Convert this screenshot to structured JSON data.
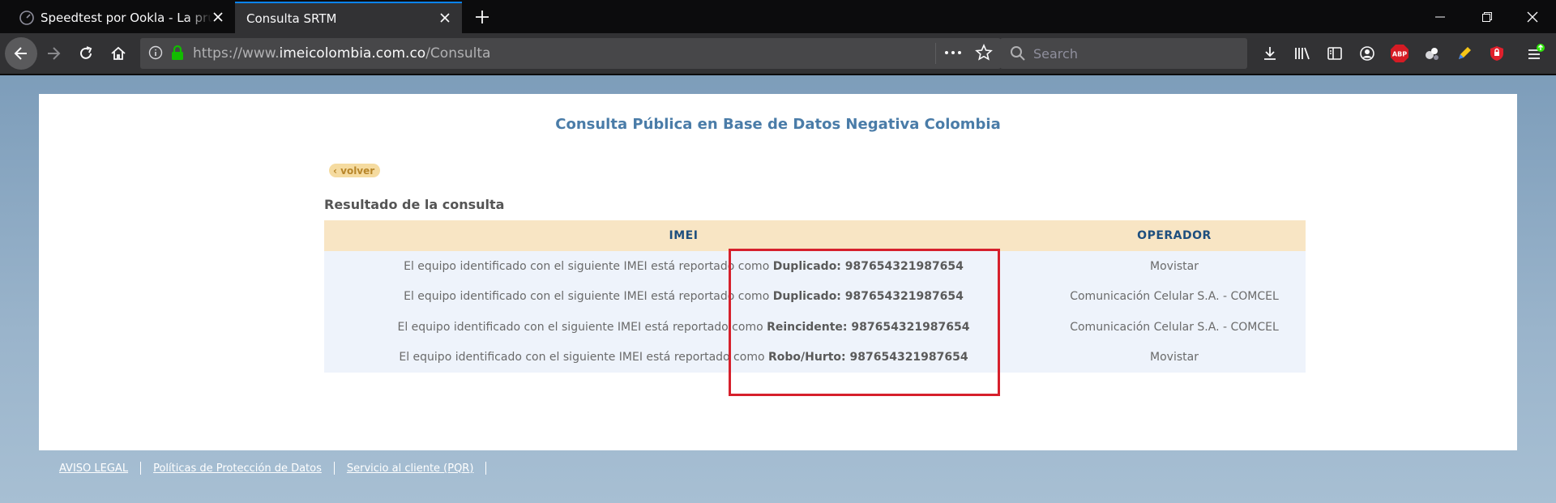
{
  "browser": {
    "tabs": [
      {
        "title": "Speedtest por Ookla - La prueba",
        "icon": "speedometer-icon",
        "active": false
      },
      {
        "title": "Consulta SRTM",
        "icon": "none",
        "active": true
      }
    ],
    "url_prefix": "https://www.",
    "url_host": "imeicolombia.com.co",
    "url_path": "/Consulta",
    "search_placeholder": "Search",
    "accent_color": "#0a84ff",
    "toolbar_icons": [
      "download-icon",
      "library-icon",
      "sidebar-icon",
      "account-icon",
      "adblock-plus-icon",
      "extension-icon",
      "pencil-extension-icon",
      "shield-extension-icon",
      "menu-icon"
    ],
    "adblock_label": "ABP"
  },
  "page": {
    "title": "Consulta Pública en Base de Datos Negativa Colombia",
    "back_label": "‹ volver",
    "section_title": "Resultado de la consulta",
    "table": {
      "headers": [
        "IMEI",
        "OPERADOR"
      ],
      "rows": [
        {
          "text": "El equipo identificado con el siguiente IMEI está reportado como ",
          "status": "Duplicado: 987654321987654",
          "operator": "Movistar"
        },
        {
          "text": "El equipo identificado con el siguiente IMEI está reportado como ",
          "status": "Duplicado: 987654321987654",
          "operator": "Comunicación Celular S.A. - COMCEL"
        },
        {
          "text": "El equipo identificado con el siguiente IMEI está reportado como ",
          "status": "Reincidente: 987654321987654",
          "operator": "Comunicación Celular S.A. - COMCEL"
        },
        {
          "text": "El equipo identificado con el siguiente IMEI está reportado como ",
          "status": "Robo/Hurto: 987654321987654",
          "operator": "Movistar"
        }
      ]
    },
    "highlight_color": "#d6202c"
  },
  "footer": {
    "links": [
      "AVISO LEGAL",
      "Políticas de Protección de Datos",
      "Servicio al cliente (PQR)"
    ]
  }
}
